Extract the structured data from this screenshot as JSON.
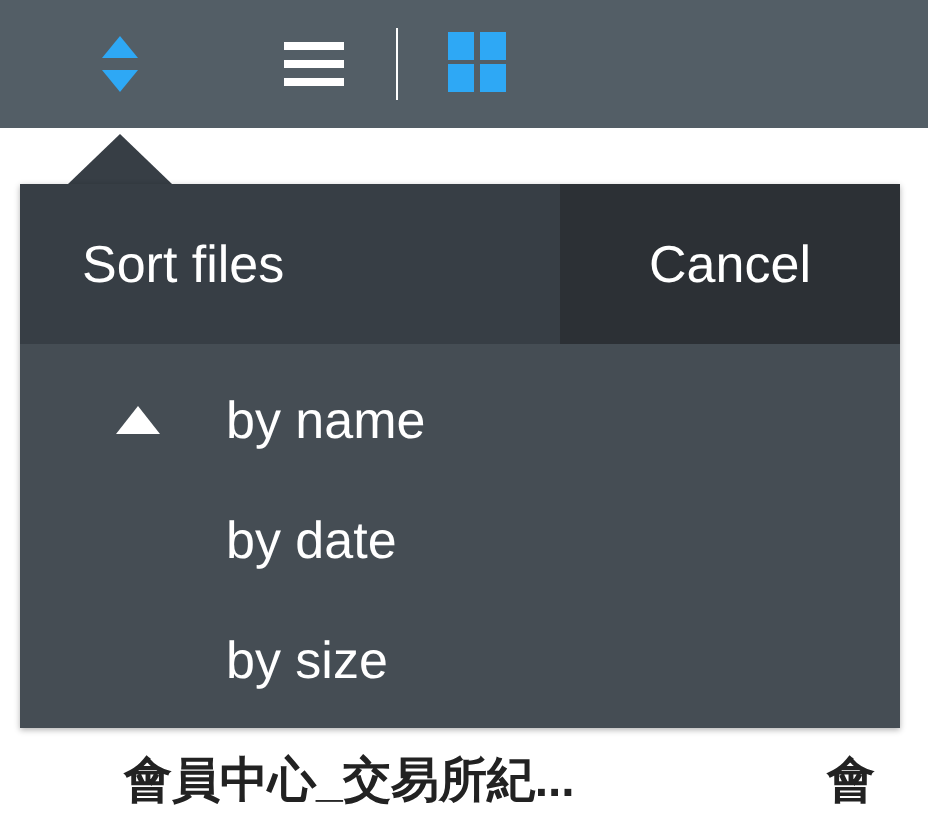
{
  "toolbar": {
    "view_modes": [
      {
        "kind": "list",
        "selected": false
      },
      {
        "kind": "grid",
        "selected": true
      }
    ]
  },
  "sort_popover": {
    "title": "Sort files",
    "cancel": "Cancel",
    "options": [
      {
        "label": "by name",
        "selected": true
      },
      {
        "label": "by date",
        "selected": false
      },
      {
        "label": "by size",
        "selected": false
      }
    ]
  },
  "files": [
    {
      "name": "會員中心_交易所紀..."
    },
    {
      "name": "會"
    }
  ]
}
